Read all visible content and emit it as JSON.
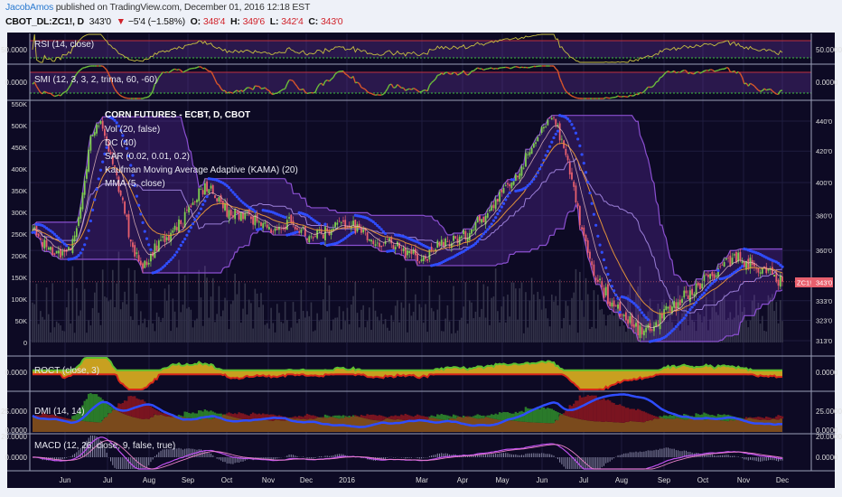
{
  "header": {
    "author": "JacobAmos",
    "published": "published on TradingView.com, December 01, 2016 12:18 EST",
    "symbol": "CBOT_DL:ZC1!, D",
    "last": "343'0",
    "change": "−5'4 (−1.58%)",
    "o_label": "O:",
    "o": "348'4",
    "h_label": "H:",
    "h": "349'6",
    "l_label": "L:",
    "l": "342'4",
    "c_label": "C:",
    "c": "343'0"
  },
  "colors": {
    "background": "#0d0a24",
    "candle_up": "#7fcf4f",
    "candle_down": "#e8606e",
    "donchian": "#8a4fd0",
    "sar": "#2f4dff",
    "kama": "#e0913a",
    "mma": "#f0c4c4",
    "tag": "#e8606e"
  },
  "chart_data": {
    "type": "candlestick",
    "title": "CORN FUTURES - ECBT, D, CBOT",
    "legend": [
      "Vol (20, false)",
      "DC (40)",
      "SAR (0.02, 0.01, 0.2)",
      "Kaufman Moving Average Adaptive (KAMA) (20)",
      "MMA (5, close)"
    ],
    "x_tick_labels": [
      "Jun",
      "Jul",
      "Aug",
      "Sep",
      "Oct",
      "Nov",
      "Dec",
      "2016",
      "Mar",
      "Apr",
      "May",
      "Jun",
      "Jul",
      "Aug",
      "Sep",
      "Oct",
      "Nov",
      "Dec"
    ],
    "price_axis": {
      "scale": "log",
      "range": [
        313,
        440
      ],
      "ticks": [
        440,
        420,
        400,
        380,
        360,
        333,
        323,
        313
      ],
      "labels": [
        "440'0",
        "420'0",
        "400'0",
        "380'0",
        "360'0",
        "333'0",
        "323'0",
        "313'0"
      ]
    },
    "volume_axis": {
      "ticks": [
        550000,
        500000,
        450000,
        400000,
        350000,
        300000,
        250000,
        200000,
        150000,
        100000,
        50000,
        0
      ],
      "labels": [
        "550K",
        "500K",
        "450K",
        "400K",
        "350K",
        "300K",
        "250K",
        "200K",
        "150K",
        "100K",
        "50K",
        "0"
      ]
    },
    "last_price_tag": {
      "symbol": "ZC1!",
      "value": "343'0"
    },
    "weekly_close": [
      372,
      366,
      362,
      356,
      360,
      385,
      430,
      440,
      418,
      392,
      365,
      352,
      358,
      366,
      370,
      375,
      385,
      396,
      398,
      388,
      380,
      382,
      378,
      374,
      370,
      372,
      376,
      372,
      368,
      370,
      372,
      376,
      374,
      370,
      366,
      362,
      364,
      360,
      358,
      355,
      360,
      366,
      364,
      368,
      372,
      378,
      386,
      394,
      400,
      410,
      422,
      436,
      442,
      428,
      402,
      372,
      352,
      340,
      332,
      326,
      320,
      316,
      318,
      324,
      330,
      334,
      336,
      342,
      346,
      352,
      356,
      354,
      352,
      350,
      347,
      343
    ],
    "panes": [
      {
        "id": "rsi",
        "label": "RSI (14, close)",
        "ticks": [
          "50.0000"
        ]
      },
      {
        "id": "smi",
        "label": "SMI (12, 3, 3, 2, trima, 60, -60)",
        "ticks": [
          "0.0000"
        ]
      },
      {
        "id": "roct",
        "label": "ROCT (close, 3)",
        "ticks": [
          "0.0000"
        ]
      },
      {
        "id": "dmi",
        "label": "DMI (14, 14)",
        "ticks": [
          "25.0000",
          "0.0000"
        ]
      },
      {
        "id": "macd",
        "label": "MACD (12, 26, close, 9, false, true)",
        "ticks": [
          "20.0000",
          "0.0000"
        ]
      }
    ]
  }
}
